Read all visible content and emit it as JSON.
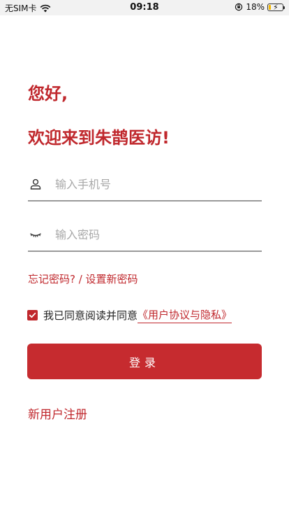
{
  "status_bar": {
    "carrier": "无SIM卡",
    "time": "09:18",
    "battery_text": "18%",
    "battery_level": 0.18,
    "icons": [
      "wifi-icon",
      "orientation-lock-icon",
      "battery-icon",
      "charging-bolt-icon"
    ]
  },
  "greeting": {
    "line1": "您好,",
    "line2": "欢迎来到朱鹊医访!"
  },
  "form": {
    "phone": {
      "placeholder": "输入手机号",
      "value": "",
      "icon": "user-icon"
    },
    "password": {
      "placeholder": "输入密码",
      "value": "",
      "icon": "eye-closed-icon"
    }
  },
  "links": {
    "forgot_password": "忘记密码? / 设置新密码",
    "register": "新用户注册"
  },
  "agreement": {
    "checked": true,
    "text": "我已同意阅读并同意",
    "link": "《用户协议与隐私》"
  },
  "login_button": {
    "label": "登录"
  },
  "colors": {
    "accent": "#c0282d",
    "button": "#c62b2f",
    "underline": "#9a9a9a",
    "status_bar_bg": "#f2f2f2"
  }
}
